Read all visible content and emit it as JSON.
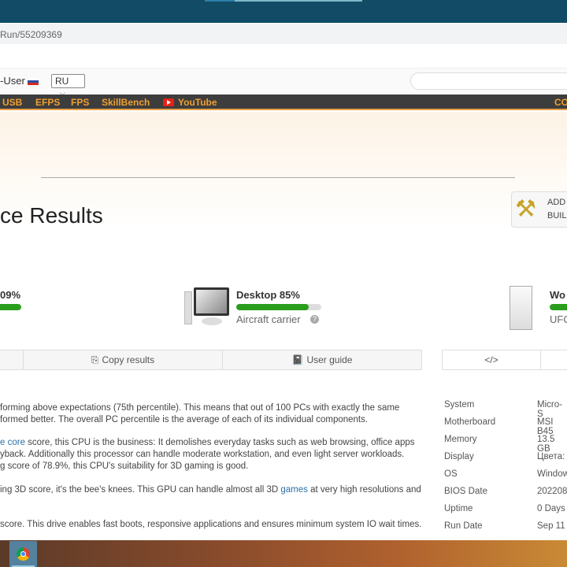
{
  "address_bar": {
    "url": "Run/55209369"
  },
  "header": {
    "user_label": "-User",
    "lang": "RU"
  },
  "nav": {
    "items": [
      "USB",
      "EFPS",
      "FPS",
      "SkillBench",
      "YouTube"
    ],
    "right": "CO"
  },
  "page": {
    "title": "ce Results",
    "add_build": [
      "ADD",
      "BUIL"
    ]
  },
  "scores": [
    {
      "label": "09%",
      "percent": 100
    },
    {
      "label": "Desktop 85%",
      "percent": 85,
      "sub": "Aircraft carrier"
    },
    {
      "label": "Wo",
      "percent": 100,
      "sub": "UFO"
    }
  ],
  "buttons": {
    "copy": "Copy results",
    "guide": "User guide",
    "embed": "</>"
  },
  "paragraphs": [
    [
      "forming above expectations (75th percentile). This means that out of 100 PCs with exactly the same",
      "formed better. The overall PC percentile is the average of each of its individual components."
    ],
    {
      "link": "e core",
      "rest": " score, this CPU is the business: It demolishes everyday tasks such as web browsing, office apps",
      "l2": "yback. Additionally this processor can handle moderate workstation, and even light server workloads.",
      "l3": "g score of 78.9%, this CPU's suitability for 3D gaming is good."
    },
    {
      "pre": "ing 3D score, it's the bee's knees. This GPU can handle almost all 3D ",
      "link": "games",
      "post": " at very high resolutions and"
    },
    "score. This drive enables fast boots, responsive applications and ensures minimum system IO wait times."
  ],
  "specs": [
    {
      "k": "System",
      "v": "Micro-S"
    },
    {
      "k": "Motherboard",
      "v": "MSI B45"
    },
    {
      "k": "Memory",
      "v": "13.5 GB"
    },
    {
      "k": "Display",
      "v": "Цвета:"
    },
    {
      "k": "OS",
      "v": "Window"
    },
    {
      "k": "BIOS Date",
      "v": "2022080"
    },
    {
      "k": "Uptime",
      "v": "0 Days"
    },
    {
      "k": "Run Date",
      "v": "Sep 11"
    }
  ],
  "colors": {
    "accent_green": "#2a9d1d",
    "nav_text": "#f0a030",
    "link": "#2a6fa8"
  }
}
